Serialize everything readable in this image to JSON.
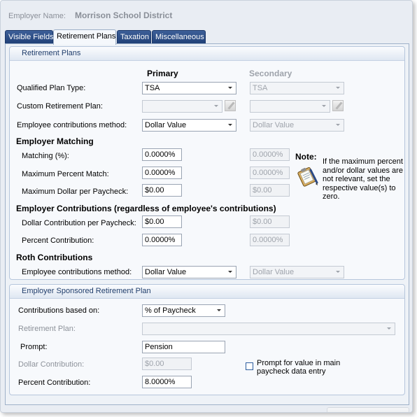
{
  "header": {
    "employer_label": "Employer Name:",
    "employer_value": "Morrison School District"
  },
  "tabs": [
    {
      "label": "Visible Fields",
      "active": false
    },
    {
      "label": "Retirement Plans",
      "active": true
    },
    {
      "label": "Taxation",
      "active": false
    },
    {
      "label": "Miscellaneous",
      "active": false
    }
  ],
  "retirement_plans": {
    "group_title": "Retirement Plans",
    "col_primary": "Primary",
    "col_secondary": "Secondary",
    "qualified_plan_type": {
      "label": "Qualified Plan Type:",
      "primary": "TSA",
      "secondary": "TSA"
    },
    "custom_retirement_plan": {
      "label": "Custom Retirement Plan:",
      "primary": "",
      "secondary": ""
    },
    "employee_contrib_method": {
      "label": "Employee contributions method:",
      "primary": "Dollar Value",
      "secondary": "Dollar Value"
    },
    "employer_matching": {
      "title": "Employer Matching",
      "matching": {
        "label": "Matching (%):",
        "primary": "0.0000%",
        "secondary": "0.0000%"
      },
      "max_percent": {
        "label": "Maximum Percent Match:",
        "primary": "0.0000%",
        "secondary": "0.0000%"
      },
      "max_dollar": {
        "label": "Maximum Dollar per Paycheck:",
        "primary": "$0.00",
        "secondary": "$0.00"
      }
    },
    "employer_contributions": {
      "title": "Employer Contributions (regardless of employee's contributions)",
      "dollar": {
        "label": "Dollar Contribution per Paycheck:",
        "primary": "$0.00",
        "secondary": "$0.00"
      },
      "percent": {
        "label": "Percent Contribution:",
        "primary": "0.0000%",
        "secondary": "0.0000%"
      }
    },
    "roth": {
      "title": "Roth Contributions",
      "method": {
        "label": "Employee contributions method:",
        "primary": "Dollar Value",
        "secondary": "Dollar Value"
      }
    },
    "note": {
      "title": "Note:",
      "text": "If the maximum percent and/or dollar values are not relevant, set the respective value(s) to zero.",
      "icon": "clipboard-pencil-icon"
    }
  },
  "sponsored": {
    "group_title": "Employer Sponsored Retirement Plan",
    "contributions_based_on": {
      "label": "Contributions based on:",
      "value": "% of Paycheck"
    },
    "retirement_plan": {
      "label": "Retirement Plan:",
      "value": ""
    },
    "prompt": {
      "label": "Prompt:",
      "value": "Pension"
    },
    "dollar_contribution": {
      "label": "Dollar Contribution:",
      "value": "$0.00"
    },
    "percent_contribution": {
      "label": "Percent Contribution:",
      "value": "8.0000%"
    },
    "prompt_checkbox": {
      "label": "Prompt for value in main paycheck data entry",
      "checked": false
    }
  }
}
